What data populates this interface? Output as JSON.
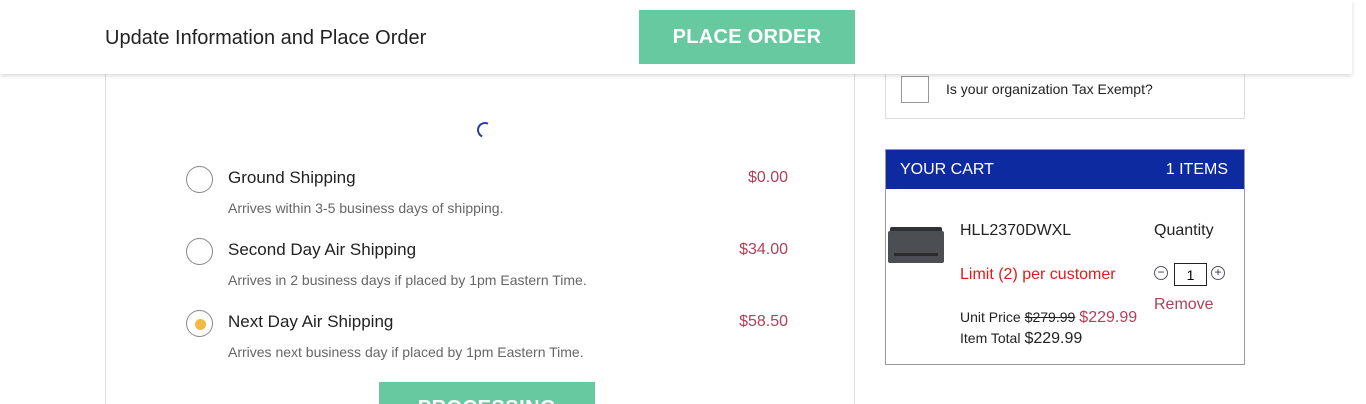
{
  "header": {
    "title": "Update Information and Place Order",
    "place_order_label": "PLACE ORDER"
  },
  "shipping": {
    "options": [
      {
        "name": "Ground Shipping",
        "description": "Arrives within 3-5 business days of shipping.",
        "price": "$0.00",
        "selected": false
      },
      {
        "name": "Second Day Air Shipping",
        "description": "Arrives in 2 business days if placed by 1pm Eastern Time.",
        "price": "$34.00",
        "selected": false
      },
      {
        "name": "Next Day Air Shipping",
        "description": "Arrives next business day if placed by 1pm Eastern Time.",
        "price": "$58.50",
        "selected": true
      }
    ],
    "processing_label": "PROCESSING"
  },
  "tax": {
    "label": "Is your organization Tax Exempt?",
    "checked": false
  },
  "cart": {
    "title": "YOUR CART",
    "item_count": "1 ITEMS",
    "item": {
      "sku": "HLL2370DWXL",
      "limit": "Limit (2) per customer",
      "unit_price_label": "Unit Price",
      "old_price": "$279.99",
      "new_price": "$229.99",
      "item_total_label": "Item Total",
      "item_total": "$229.99",
      "quantity_label": "Quantity",
      "quantity": "1",
      "remove_label": "Remove"
    }
  },
  "colors": {
    "accent_green": "#66c9a0",
    "cart_header_blue": "#0e2aa0",
    "price_red": "#b0405a",
    "limit_red": "#e11b1b",
    "radio_selected": "#f4b844"
  },
  "icons": [
    "loading-spinner-icon",
    "minus-circle-icon",
    "plus-circle-icon"
  ]
}
